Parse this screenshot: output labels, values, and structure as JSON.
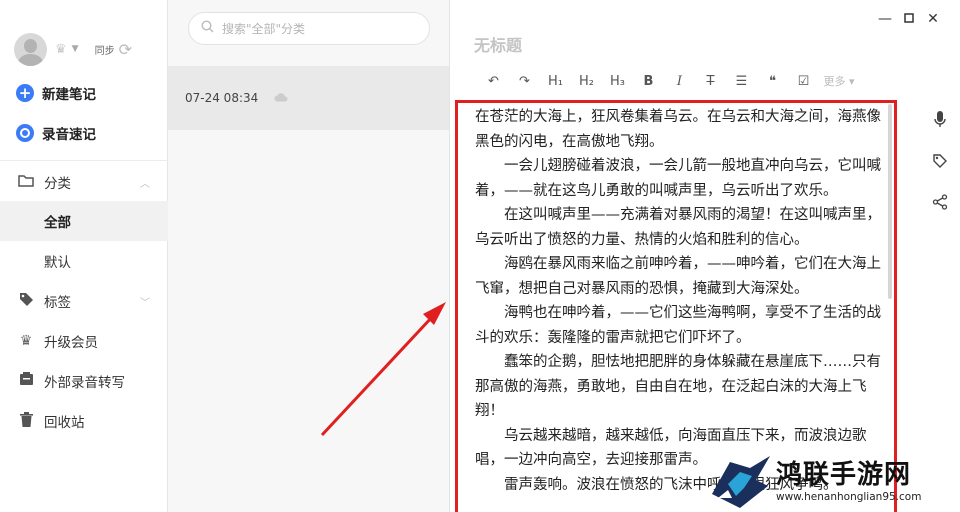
{
  "sidebar": {
    "sync_label": "同步",
    "new_note": "新建笔记",
    "voice_note": "录音速记",
    "category": "分类",
    "all": "全部",
    "default": "默认",
    "tags": "标签",
    "upgrade": "升级会员",
    "transcribe": "外部录音转写",
    "trash": "回收站"
  },
  "list": {
    "search_placeholder": "搜索\"全部\"分类",
    "notes": [
      {
        "date": "07-24 08:34"
      }
    ]
  },
  "editor": {
    "title_placeholder": "无标题",
    "toolbar": {
      "h1": "H₁",
      "h2": "H₂",
      "h3": "H₃",
      "bold": "B",
      "italic": "I",
      "strike": "T",
      "quote": "❝",
      "more": "更多"
    },
    "paragraphs": [
      "在苍茫的大海上，狂风卷集着乌云。在乌云和大海之间，海燕像黑色的闪电，在高傲地飞翔。",
      "一会儿翅膀碰着波浪，一会儿箭一般地直冲向乌云，它叫喊着，——就在这鸟儿勇敢的叫喊声里，乌云听出了欢乐。",
      "在这叫喊声里——充满着对暴风雨的渴望！在这叫喊声里，乌云听出了愤怒的力量、热情的火焰和胜利的信心。",
      "海鸥在暴风雨来临之前呻吟着，——呻吟着，它们在大海上飞窜，想把自己对暴风雨的恐惧，掩藏到大海深处。",
      "海鸭也在呻吟着，——它们这些海鸭啊，享受不了生活的战斗的欢乐：轰隆隆的雷声就把它们吓坏了。",
      "蠢笨的企鹅，胆怯地把肥胖的身体躲藏在悬崖底下……只有那高傲的海燕，勇敢地，自由自在地，在泛起白沫的大海上飞翔！",
      "乌云越来越暗，越来越低，向海面直压下来，而波浪边歌唱，一边冲向高空，去迎接那雷声。",
      "雷声轰响。波浪在愤怒的飞沫中呼叫，跟狂风争鸣。"
    ]
  },
  "watermark": {
    "name": "鸿联手游网",
    "url": "www.henanhonglian95.com"
  },
  "colors": {
    "accent": "#3a7bf6",
    "highlight_box": "#e02020"
  }
}
